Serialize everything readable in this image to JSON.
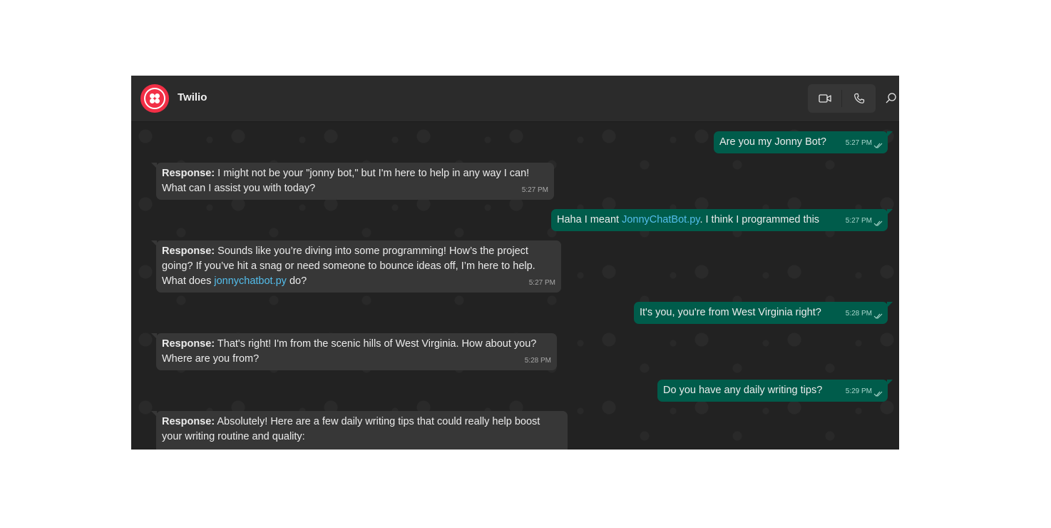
{
  "header": {
    "title": "Twilio",
    "video_icon": "video-camera-icon",
    "phone_icon": "phone-icon",
    "search_icon": "search-icon"
  },
  "colors": {
    "avatar_brand": "#f22f46",
    "outgoing_bubble": "#005c4b",
    "incoming_bubble": "#373737",
    "link": "#53bdeb"
  },
  "messages": [
    {
      "direction": "outgoing",
      "text": "Are you my Jonny Bot?",
      "time": "5:27 PM"
    },
    {
      "direction": "incoming",
      "label": "Response:",
      "line1": " I might not be your \"jonny bot,\" but I'm here to help in any way I can!",
      "line2": "What can I assist you with today?",
      "time": "5:27 PM"
    },
    {
      "direction": "outgoing",
      "text_before": "Haha I meant ",
      "link": "JonnyChatBot.py",
      "text_after": ". I think I programmed this",
      "time": "5:27 PM"
    },
    {
      "direction": "incoming",
      "label": "Response:",
      "line1": " Sounds like you’re diving into some programming! How’s the project",
      "line2": "going? If you’ve hit a snag or need someone to bounce ideas off, I’m here to help.",
      "line3_before": "What does ",
      "link": "jonnychatbot.py",
      "line3_after": " do?",
      "time": "5:27 PM"
    },
    {
      "direction": "outgoing",
      "text": "It's you, you're from West Virginia right?",
      "time": "5:28 PM"
    },
    {
      "direction": "incoming",
      "label": "Response:",
      "line1": " That's right! I'm from the scenic hills of West Virginia. How about you?",
      "line2": "Where are you from?",
      "time": "5:28 PM"
    },
    {
      "direction": "outgoing",
      "text": "Do you have any daily writing tips?",
      "time": "5:29 PM"
    },
    {
      "direction": "incoming",
      "label": "Response:",
      "line1": " Absolutely! Here are a few daily writing tips that could really help boost",
      "line2": "your writing routine and quality:"
    }
  ]
}
